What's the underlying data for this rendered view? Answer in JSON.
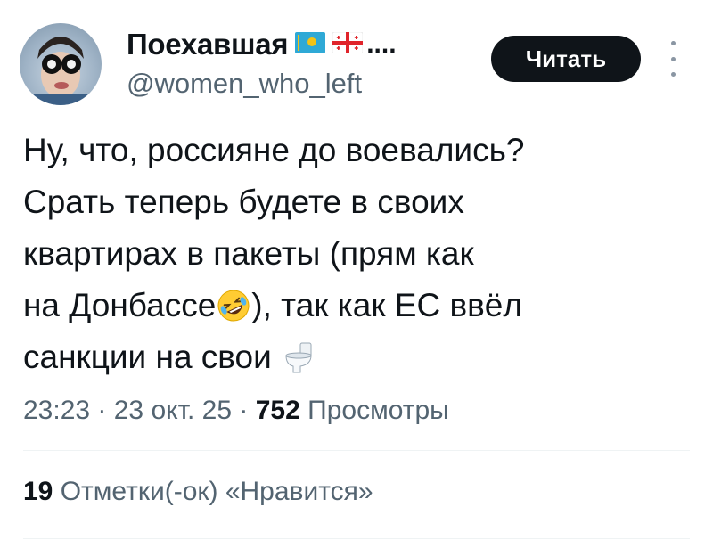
{
  "author": {
    "display_name": "Поехавшая",
    "flags": [
      "kazakhstan-flag",
      "georgia-flag"
    ],
    "name_truncation": "....",
    "handle": "@women_who_left",
    "avatar_icon": "avatar-photo"
  },
  "follow_button": {
    "label": "Читать"
  },
  "more_button": {
    "icon": "more-vertical-icon"
  },
  "tweet": {
    "lines": [
      "Ну, что, россияне до воевались?",
      "Срать теперь будете в своих",
      "квартирах в пакеты (прям как",
      "на Донбассе",
      "), так как ЕС ввёл",
      "санкции на свои "
    ],
    "emojis": [
      "rolling-on-floor-laughing-emoji",
      "toilet-emoji"
    ]
  },
  "meta": {
    "time": "23:23",
    "sep1": " · ",
    "date": "23 окт. 25",
    "sep2": " · ",
    "views_count": "752",
    "views_label": " Просмотры"
  },
  "likes": {
    "count": "19",
    "label": " Отметки(-ок) «Нравится»"
  },
  "colors": {
    "text": "#0f1419",
    "secondary": "#536471",
    "follow_bg": "#0f1419",
    "follow_text": "#ffffff",
    "divider": "#eff3f4"
  }
}
